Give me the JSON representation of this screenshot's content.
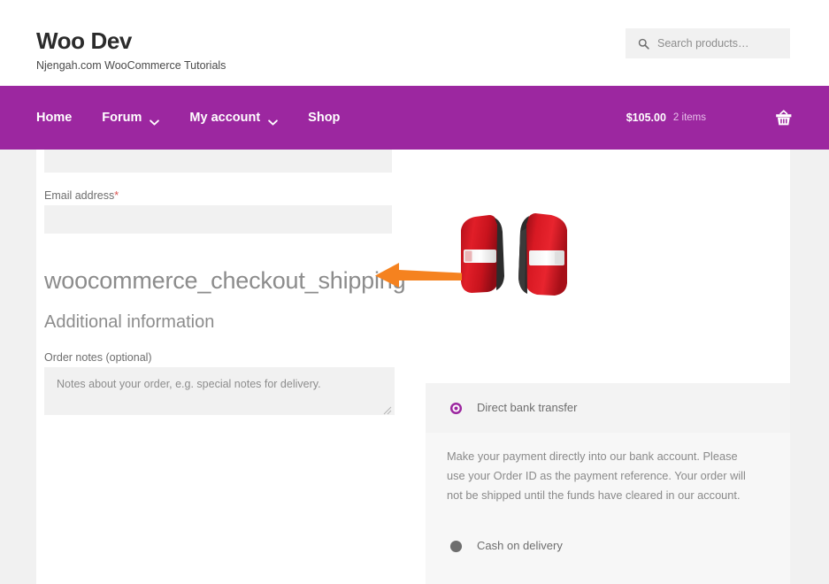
{
  "header": {
    "brand_title": "Woo Dev",
    "brand_tagline": "Njengah.com WooCommerce Tutorials",
    "search": {
      "icon": "search-icon",
      "placeholder": "Search products…"
    }
  },
  "nav": {
    "items": [
      {
        "label": "Home",
        "has_dropdown": false
      },
      {
        "label": "Forum",
        "has_dropdown": true,
        "icon": "chevron-down-icon"
      },
      {
        "label": "My account",
        "has_dropdown": true,
        "icon": "chevron-down-icon"
      },
      {
        "label": "Shop",
        "has_dropdown": false
      }
    ],
    "cart": {
      "total": "$105.00",
      "count": "2 items",
      "icon": "shopping-basket-icon"
    }
  },
  "checkout": {
    "email_label": "Email address",
    "required_mark": "*",
    "shipping_heading": "woocommerce_checkout_shipping",
    "additional_heading": "Additional information",
    "order_notes_label": "Order notes (optional)",
    "order_notes_placeholder": "Notes about your order, e.g. special notes for delivery."
  },
  "product": {
    "image_alt": "car-tail-lights-image"
  },
  "payment": {
    "options": [
      {
        "label": "Direct bank transfer",
        "selected": true,
        "description": "Make your payment directly into our bank account. Please use your Order ID as the payment reference. Your order will not be shipped until the funds have cleared in our account."
      },
      {
        "label": "Cash on delivery",
        "selected": false,
        "description": ""
      }
    ]
  },
  "annotation": {
    "arrow": "left-pointing-arrow",
    "color": "#f5821f"
  },
  "colors": {
    "brand_purple": "#9c27a0",
    "page_bg": "#f1f1f1",
    "field_bg": "#f1f1f1",
    "heading_gray": "#8c8c8c",
    "required_red": "#d9534f",
    "annotation_orange": "#f5821f"
  }
}
